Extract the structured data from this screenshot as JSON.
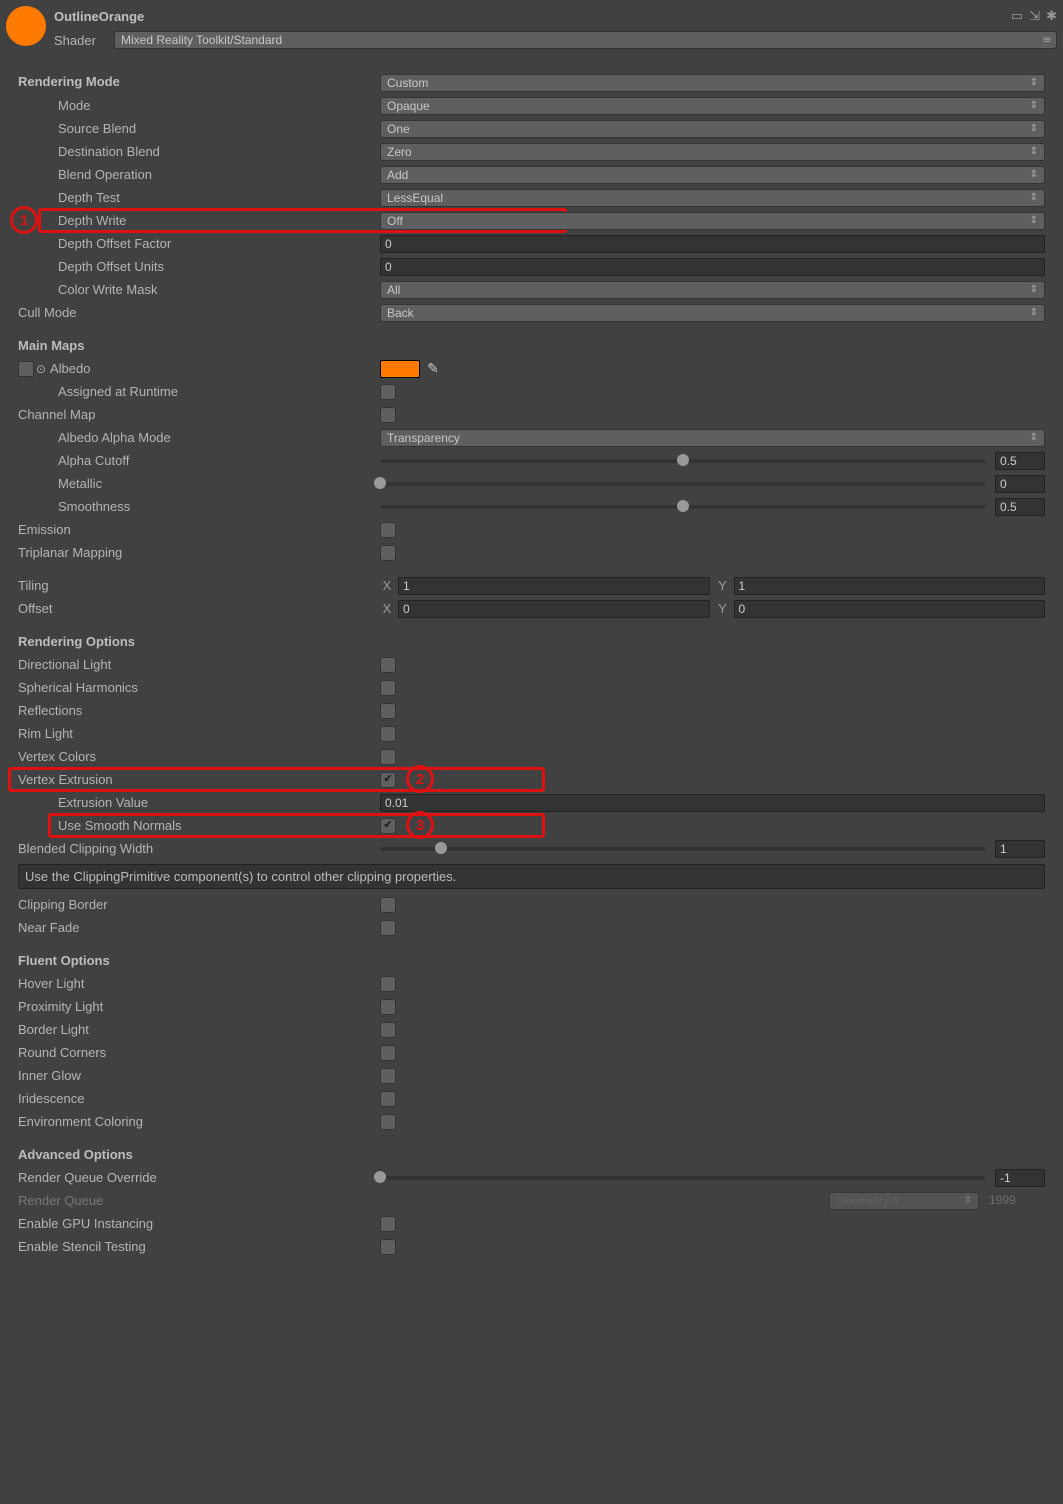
{
  "header": {
    "title": "OutlineOrange",
    "shader_label": "Shader",
    "shader_value": "Mixed Reality Toolkit/Standard"
  },
  "sections": {
    "rendering_mode": "Rendering Mode",
    "main_maps": "Main Maps",
    "rendering_options": "Rendering Options",
    "fluent_options": "Fluent Options",
    "advanced_options": "Advanced Options"
  },
  "rendering": {
    "rendering_mode_value": "Custom",
    "mode_label": "Mode",
    "mode_value": "Opaque",
    "source_blend_label": "Source Blend",
    "source_blend_value": "One",
    "destination_blend_label": "Destination Blend",
    "destination_blend_value": "Zero",
    "blend_operation_label": "Blend Operation",
    "blend_operation_value": "Add",
    "depth_test_label": "Depth Test",
    "depth_test_value": "LessEqual",
    "depth_write_label": "Depth Write",
    "depth_write_value": "Off",
    "depth_offset_factor_label": "Depth Offset Factor",
    "depth_offset_factor_value": "0",
    "depth_offset_units_label": "Depth Offset Units",
    "depth_offset_units_value": "0",
    "color_write_mask_label": "Color Write Mask",
    "color_write_mask_value": "All",
    "cull_mode_label": "Cull Mode",
    "cull_mode_value": "Back"
  },
  "mainmaps": {
    "albedo_label": "Albedo",
    "assigned_runtime_label": "Assigned at Runtime",
    "channel_map_label": "Channel Map",
    "albedo_alpha_label": "Albedo Alpha Mode",
    "albedo_alpha_value": "Transparency",
    "alpha_cutoff_label": "Alpha Cutoff",
    "alpha_cutoff_value": "0.5",
    "metallic_label": "Metallic",
    "metallic_value": "0",
    "smoothness_label": "Smoothness",
    "smoothness_value": "0.5",
    "emission_label": "Emission",
    "triplanar_label": "Triplanar Mapping",
    "tiling_label": "Tiling",
    "tiling_x": "1",
    "tiling_y": "1",
    "offset_label": "Offset",
    "offset_x": "0",
    "offset_y": "0",
    "albedo_color": "#ff7a00"
  },
  "rendopts": {
    "directional_light": "Directional Light",
    "spherical_harmonics": "Spherical Harmonics",
    "reflections": "Reflections",
    "rim_light": "Rim Light",
    "vertex_colors": "Vertex Colors",
    "vertex_extrusion": "Vertex Extrusion",
    "extrusion_value_label": "Extrusion Value",
    "extrusion_value": "0.01",
    "use_smooth_normals": "Use Smooth Normals",
    "blended_clip_label": "Blended Clipping Width",
    "blended_clip_value": "1",
    "clip_note": "Use the ClippingPrimitive component(s) to control other clipping properties.",
    "clipping_border": "Clipping Border",
    "near_fade": "Near Fade"
  },
  "fluent": {
    "hover_light": "Hover Light",
    "proximity_light": "Proximity Light",
    "border_light": "Border Light",
    "round_corners": "Round Corners",
    "inner_glow": "Inner Glow",
    "iridescence": "Iridescence",
    "environment_coloring": "Environment Coloring"
  },
  "advanced": {
    "render_queue_override_label": "Render Queue Override",
    "render_queue_override_value": "-1",
    "render_queue_label": "Render Queue",
    "render_queue_drop": "Geometry-1",
    "render_queue_value": "1999",
    "gpu_instancing": "Enable GPU Instancing",
    "stencil_testing": "Enable Stencil Testing"
  },
  "annotations": {
    "a1": "1",
    "a2": "2",
    "a3": "3"
  }
}
